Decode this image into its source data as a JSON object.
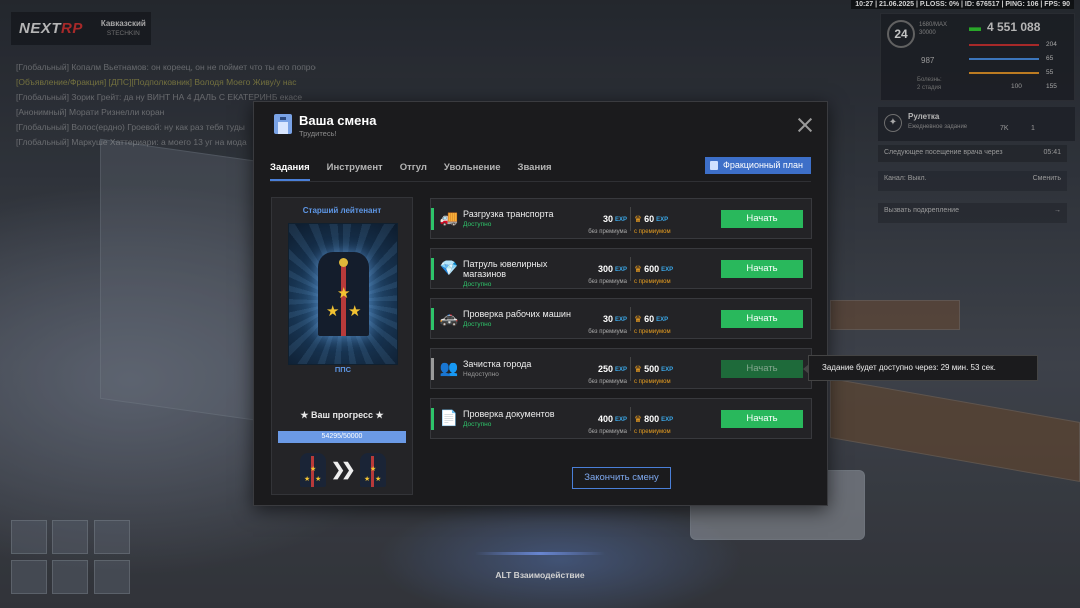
{
  "hud": {
    "top_status": "10:27 | 21.06.2025 | P.LOSS: 0% | ID: 676517 | PING: 106 | FPS: 90",
    "brand_prefix": "NEXT",
    "brand_suffix": "RP",
    "server_name": "Кавказский",
    "server_sub": "STECHKIN",
    "level": "24",
    "level_sub1": "1680/MAX",
    "level_sub2": "30000",
    "money": "4 551 088",
    "stat_values": [
      "204",
      "65",
      "55",
      "155"
    ],
    "donate": "987",
    "disease1": "Болезнь:",
    "disease2": "2 стадия",
    "stat_100": "100",
    "roulette_title": "Рулетка",
    "roulette_sub": "Ежедневное задание",
    "roulette_values": [
      "7K",
      "1"
    ],
    "doctor_visit": "Следующее посещение врача через",
    "doctor_time": "05:41",
    "channel_label": "Канал: Выкл.",
    "channel_action": "Сменить",
    "backup": "Вызвать подкрепление",
    "alt_hint": "ALT Взаимодействие"
  },
  "chat": [
    {
      "text": "[Глобальный] Копалм Вьетнамов: он кореец, он не поймет что ты его попросил",
      "hl": false
    },
    {
      "text": "[Объявление/Фракция] [ДПС][Подполковник] Володя Моего Живу/у нас",
      "hl": true
    },
    {
      "text": "[Глобальный] Зорик Грейт: да ну ВИНТ НА 4 ДАЛЬ С ЕКАТЕРИНБ екасе",
      "hl": false
    },
    {
      "text": "[Анонимный] Морати Ризнелли коран",
      "hl": false
    },
    {
      "text": "[Глобальный] Волос(ердно) Гроевой: ну как раз тебя туды",
      "hl": false
    },
    {
      "text": "[Глобальный] Маркуше Хаттериари: а моего 13 уг на мода",
      "hl": false
    }
  ],
  "modal": {
    "title": "Ваша смена",
    "subtitle": "Трудитесь!",
    "tabs": [
      "Задания",
      "Инструмент",
      "Отгул",
      "Увольнение",
      "Звания"
    ],
    "faction_plan": "Фракционный план",
    "end_shift": "Закончить смену"
  },
  "rank": {
    "title": "Старший лейтенант",
    "caption": "ППС",
    "progress_label": "★ Ваш прогресс ★",
    "progress_text": "54295/50000",
    "progress_fraction": 1.0
  },
  "tasks": [
    {
      "name": "Разгрузка транспорта",
      "status": "Доступно",
      "locked": false,
      "icon": "🚚",
      "exp_base": "30",
      "exp_premium": "60"
    },
    {
      "name": "Патруль ювелирных магазинов",
      "status": "Доступно",
      "locked": false,
      "icon": "💎",
      "exp_base": "300",
      "exp_premium": "600"
    },
    {
      "name": "Проверка рабочих машин",
      "status": "Доступно",
      "locked": false,
      "icon": "🚓",
      "exp_base": "30",
      "exp_premium": "60"
    },
    {
      "name": "Зачистка города",
      "status": "Недоступно",
      "locked": true,
      "icon": "👥",
      "exp_base": "250",
      "exp_premium": "500"
    },
    {
      "name": "Проверка документов",
      "status": "Доступно",
      "locked": false,
      "icon": "📄",
      "exp_base": "400",
      "exp_premium": "800"
    }
  ],
  "labels": {
    "exp": "EXP",
    "no_premium": "без премиума",
    "with_premium": "с премиумом",
    "start": "Начать",
    "crown": "♛"
  },
  "tooltip": "Задание будет доступно через: 29 мин. 53 сек."
}
